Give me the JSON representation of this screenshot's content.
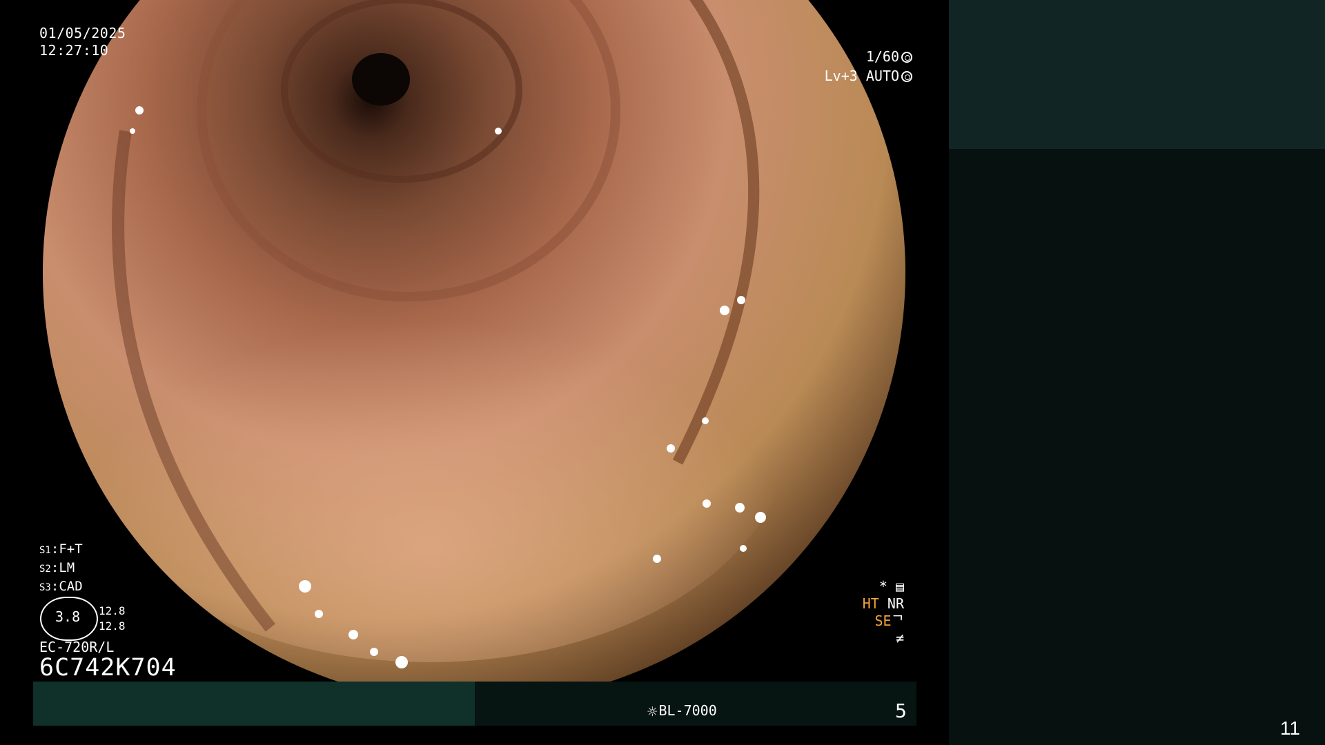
{
  "overlay": {
    "date": "01/05/2025",
    "time": "12:27:10",
    "shutter": "1/60",
    "level": "Lv+3",
    "mode": "AUTO"
  },
  "scope": {
    "s1_key": "S1",
    "s1": "F+T",
    "s2_key": "S2",
    "s2": "LM",
    "s3_key": "S3",
    "s3": "CAD",
    "gauge_value": "3.8",
    "gauge_r1": "12.8",
    "gauge_r2": "12.8",
    "model": "EC-720R/L",
    "serial": "6C742K704"
  },
  "status": {
    "star_icon": "asterisk-icon",
    "ht": "HT",
    "nr": "NR",
    "se": "SE"
  },
  "footer": {
    "light_source": "BL-7000",
    "frame_number": "5"
  },
  "page": {
    "number": "11"
  },
  "colors": {
    "panel_top": "#112624",
    "panel_bottom": "#061110",
    "accent_orange": "#f2a33a"
  }
}
